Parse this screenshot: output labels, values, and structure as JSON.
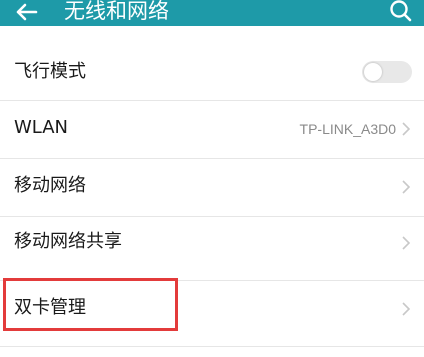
{
  "header": {
    "title": "无线和网络",
    "back_icon": "arrow-left-icon",
    "search_icon": "search-icon",
    "background": "#1e9aa8"
  },
  "settings": {
    "airplane_mode": {
      "label": "飞行模式",
      "toggle_on": false
    },
    "wlan": {
      "label": "WLAN",
      "value": "TP-LINK_A3D0"
    },
    "mobile_network": {
      "label": "移动网络"
    },
    "tethering": {
      "label": "移动网络共享"
    },
    "dual_sim": {
      "label": "双卡管理"
    }
  },
  "highlight_color": "#e33b3b"
}
